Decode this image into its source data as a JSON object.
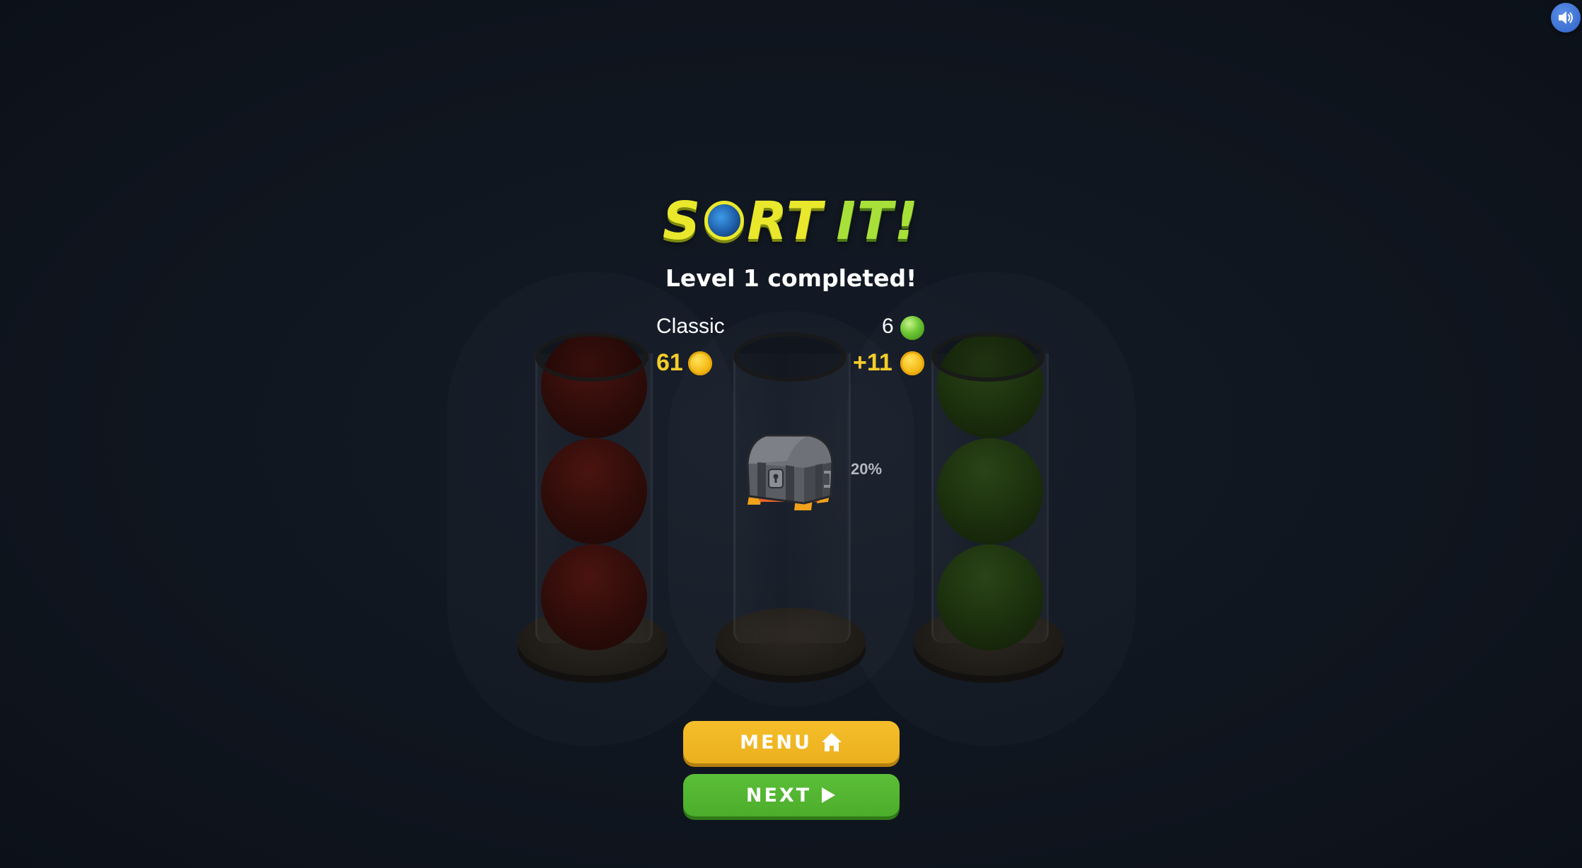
{
  "game": {
    "title_part1": "S",
    "title_part2": "RT",
    "title_part3": "IT!",
    "level_message": "Level 1 completed!"
  },
  "stats": {
    "mode": "Classic",
    "gems": "6",
    "coins_total": "61",
    "coins_earned": "+11"
  },
  "chest": {
    "progress_label": "20%"
  },
  "buttons": {
    "menu_label": "MENU",
    "next_label": "NEXT"
  },
  "colors": {
    "menu_button": "#ebb01e",
    "next_button": "#4cad2b",
    "coin_text": "#f4cd2a",
    "title_yellow": "#e9e82c",
    "title_green": "#a8e03a",
    "sound_button": "#2f62c8"
  },
  "icons": {
    "sound": "speaker-icon",
    "menu": "home-icon",
    "next": "play-icon",
    "coin": "coin-icon",
    "gem": "green-ball-icon",
    "chest": "treasure-chest-icon"
  },
  "board": {
    "tubes": [
      {
        "balls": [
          "red",
          "red",
          "red"
        ]
      },
      {
        "balls": []
      },
      {
        "balls": [
          "green",
          "green",
          "green"
        ]
      }
    ]
  }
}
